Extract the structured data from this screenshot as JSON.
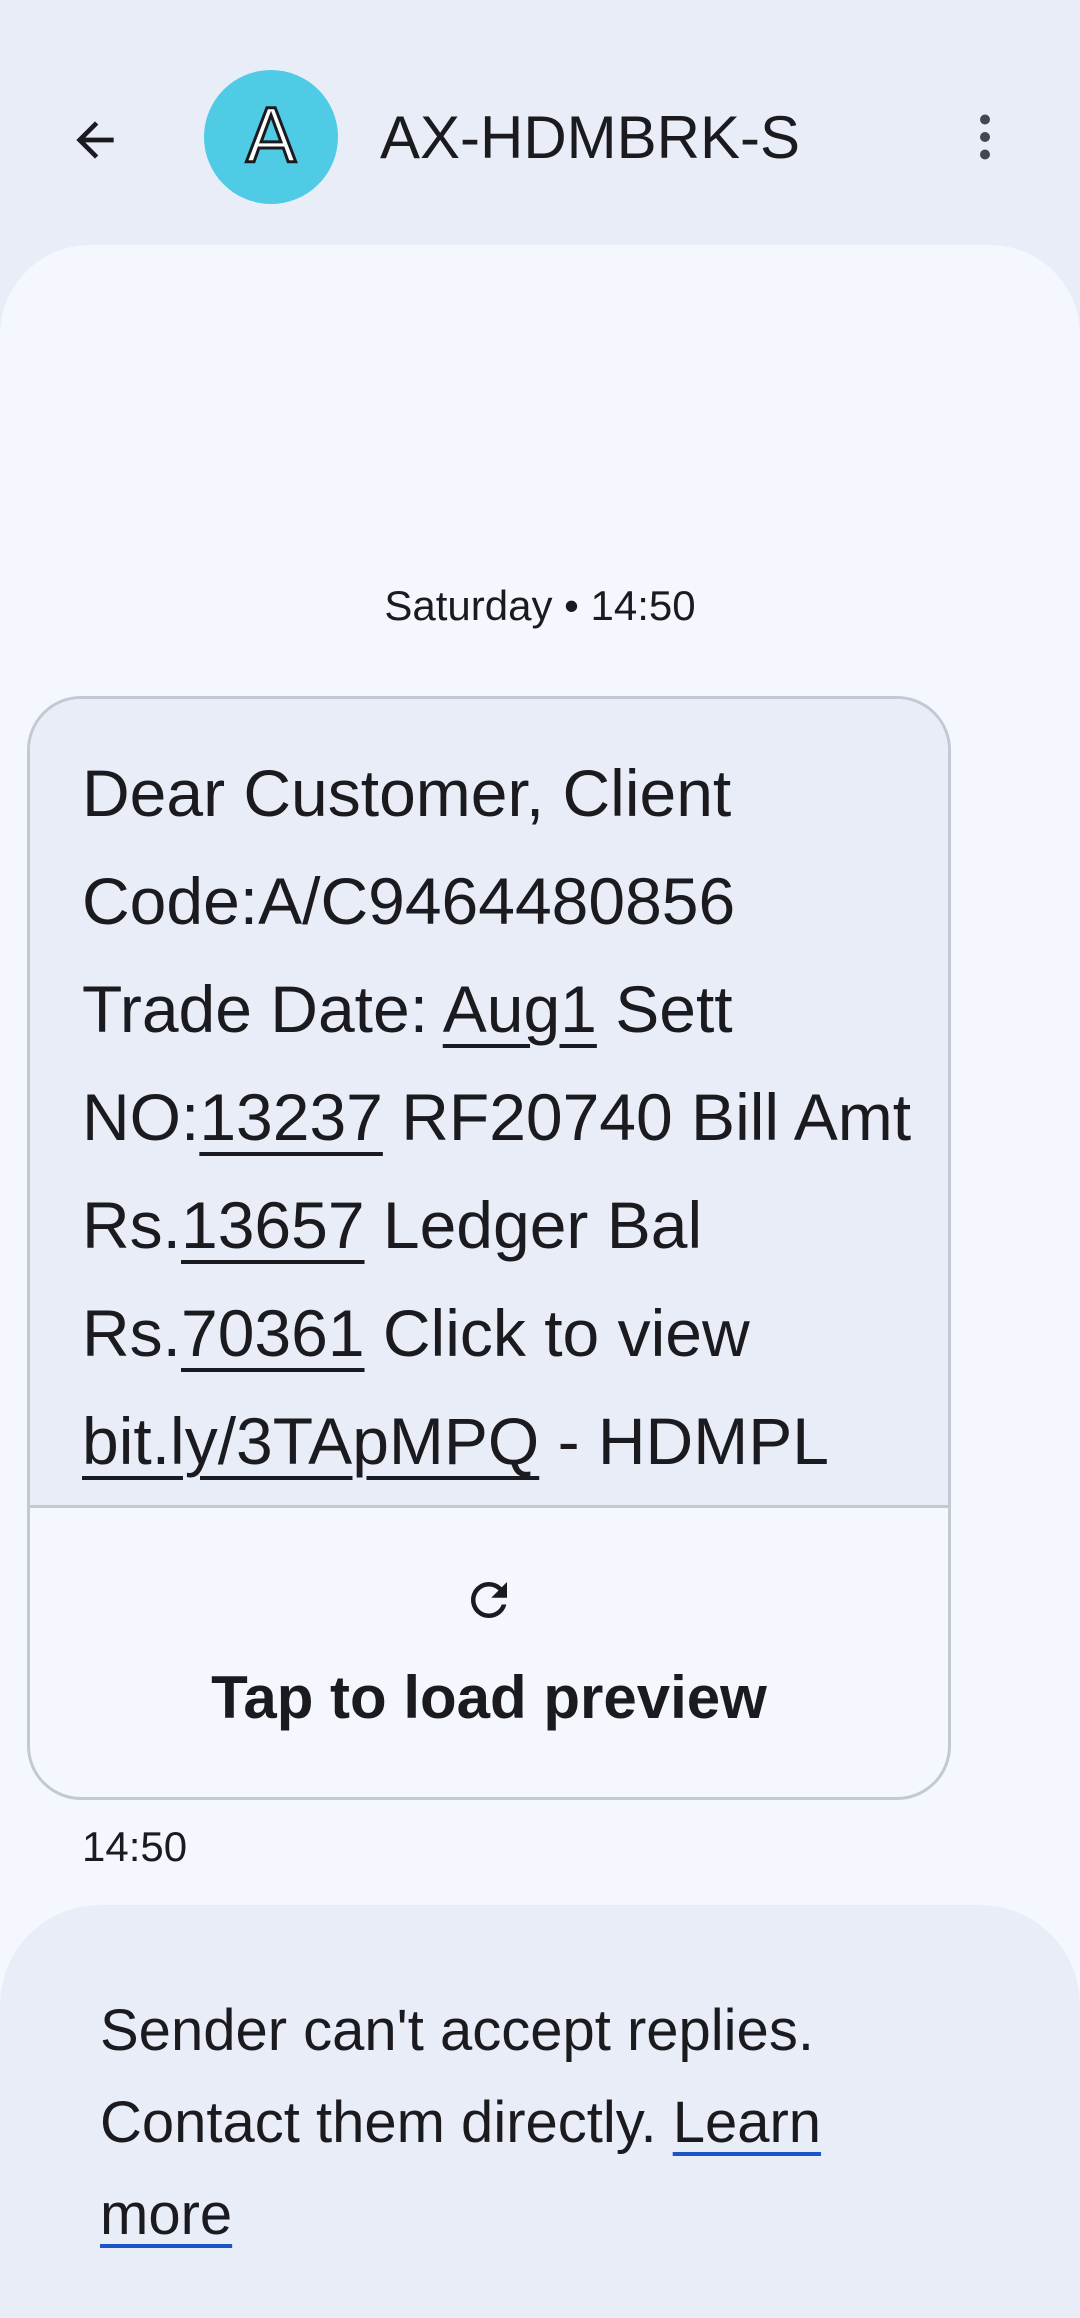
{
  "header": {
    "back_icon": "arrow-left-icon",
    "avatar_letter": "A",
    "avatar_color": "#4fcbe6",
    "sender": "AX-HDMBRK-S",
    "more_icon": "more-vert-icon"
  },
  "conversation": {
    "date_divider": "Saturday • 14:50",
    "message": {
      "segments": [
        {
          "text": "Dear Customer, Client Code:A/C9464480856 Trade Date: ",
          "link": false
        },
        {
          "text": "Aug1",
          "link": true
        },
        {
          "text": " Sett NO:",
          "link": false
        },
        {
          "text": "13237",
          "link": true
        },
        {
          "text": " RF20740 Bill Amt Rs.",
          "link": false
        },
        {
          "text": "13657",
          "link": true
        },
        {
          "text": " Ledger Bal Rs.",
          "link": false
        },
        {
          "text": "70361",
          "link": true
        },
        {
          "text": " Click to view ",
          "link": false
        },
        {
          "text": "bit.ly/3TApMPQ",
          "link": true
        },
        {
          "text": " - HDMPL",
          "link": false
        }
      ],
      "preview_icon": "refresh-icon",
      "preview_label": "Tap to load preview",
      "time": "14:50"
    }
  },
  "notice": {
    "text": "Sender can't accept replies. Contact them directly. ",
    "link": "Learn more",
    "link_color": "#1a56c8"
  }
}
